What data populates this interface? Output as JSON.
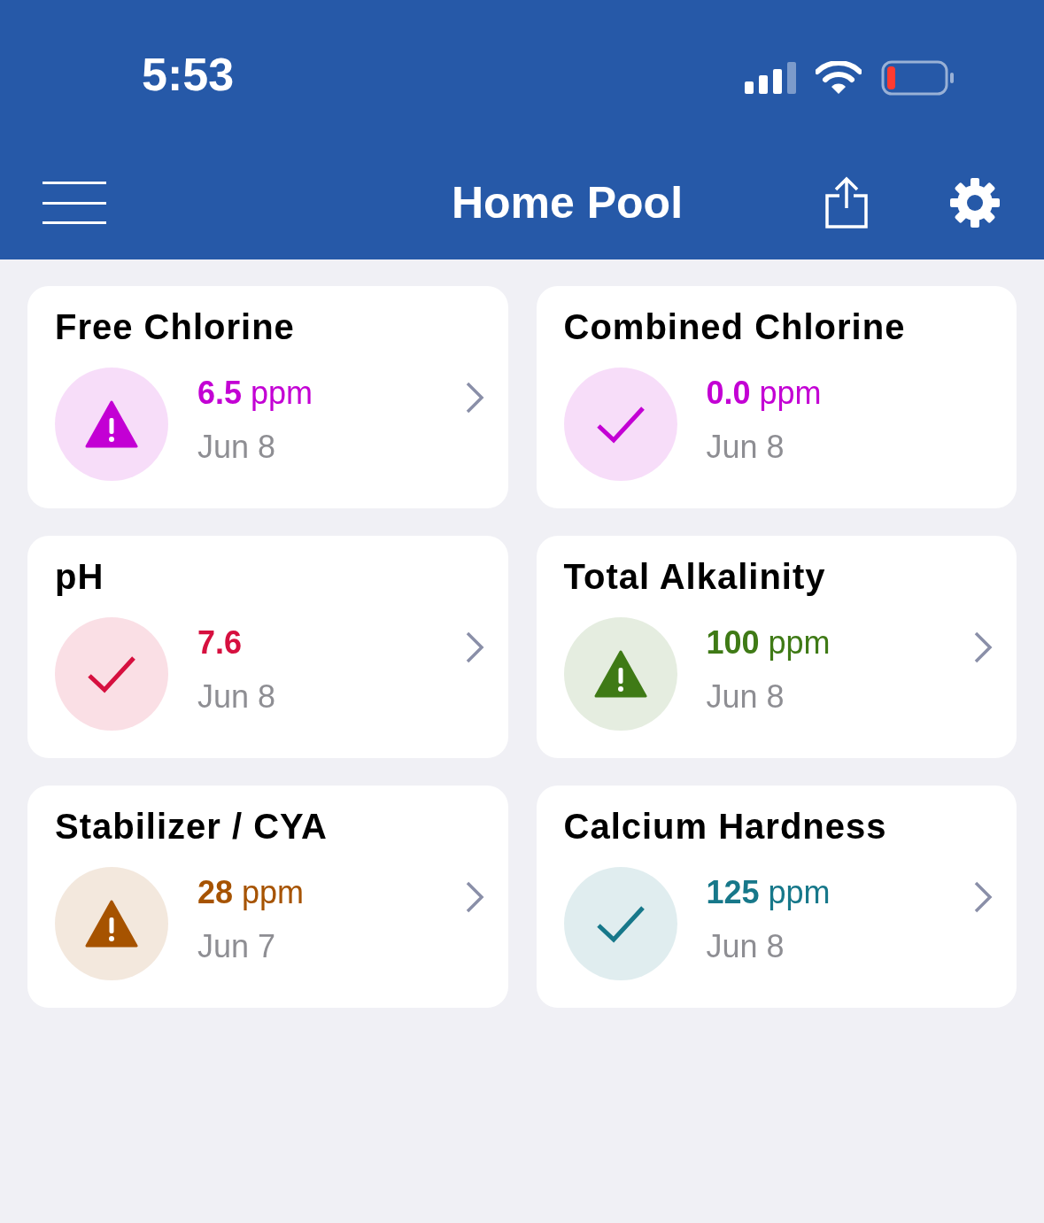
{
  "status_bar": {
    "time": "5:53"
  },
  "header": {
    "title": "Home Pool"
  },
  "cards": [
    {
      "title": "Free Chlorine",
      "value": "6.5",
      "unit": "ppm",
      "date": "Jun 8",
      "kind": "warning",
      "color": "#c300d4",
      "chevron": true
    },
    {
      "title": "Combined Chlorine",
      "value": "0.0",
      "unit": "ppm",
      "date": "Jun 8",
      "kind": "ok",
      "color": "#c300d4",
      "chevron": false
    },
    {
      "title": "pH",
      "value": "7.6",
      "date": "Jun 8",
      "kind": "ok",
      "color": "#d6103f",
      "chevron": true
    },
    {
      "title": "Total Alkalinity",
      "value": "100",
      "unit": "ppm",
      "date": "Jun 8",
      "kind": "warning",
      "color": "#3f7a16",
      "chevron": true
    },
    {
      "title": "Stabilizer / CYA",
      "value": "28",
      "unit": "ppm",
      "date": "Jun 7",
      "kind": "warning",
      "color": "#a65300",
      "chevron": true
    },
    {
      "title": "Calcium Hardness",
      "value": "125",
      "unit": "ppm",
      "date": "Jun 8",
      "kind": "ok",
      "color": "#17788a",
      "chevron": true
    }
  ]
}
